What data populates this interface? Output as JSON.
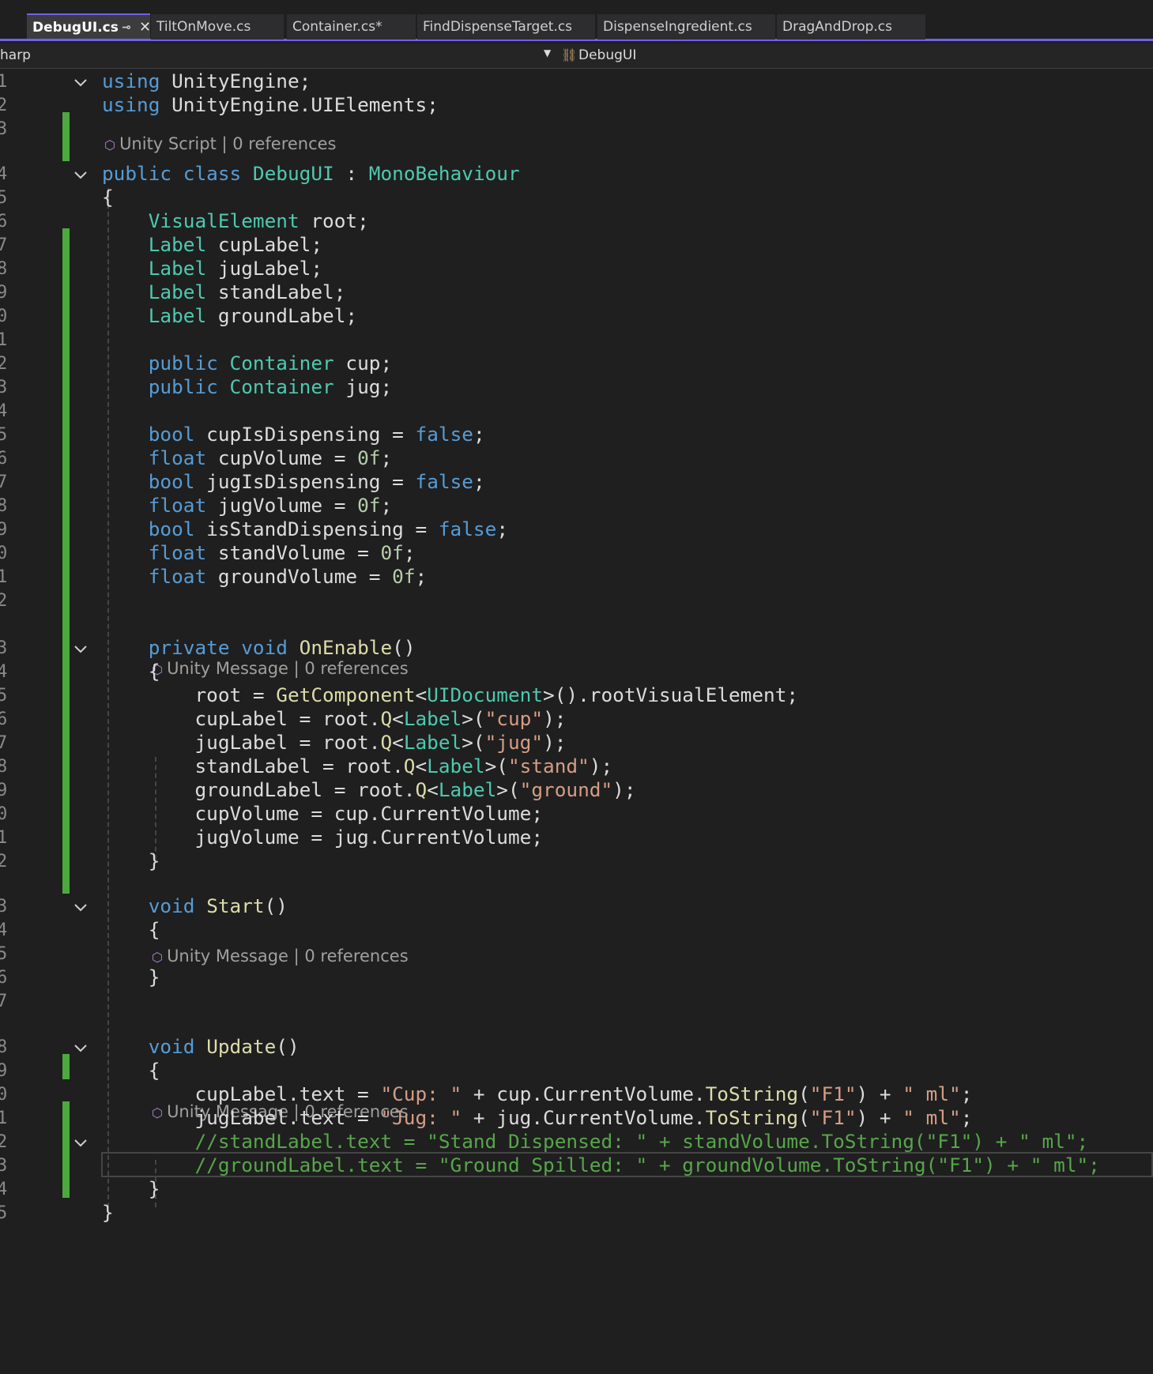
{
  "tabs": [
    {
      "label": "DebugUI.cs",
      "active": true
    },
    {
      "label": "TiltOnMove.cs",
      "active": false
    },
    {
      "label": "Container.cs*",
      "active": false
    },
    {
      "label": "FindDispenseTarget.cs",
      "active": false
    },
    {
      "label": "DispenseIngredient.cs",
      "active": false
    },
    {
      "label": "DragAndDrop.cs",
      "active": false
    }
  ],
  "tab_pin_icon": "pin-icon",
  "tab_close_icon": "close-icon",
  "nav": {
    "project": "harp",
    "member": "DebugUI"
  },
  "colors": {
    "accent": "#7160e8",
    "change_bar": "#4ea840",
    "keyword": "#569cd6",
    "type": "#4ec9b0",
    "method": "#dcdcaa",
    "string": "#d69d85",
    "number": "#b5cea8",
    "comment": "#57a64a"
  },
  "codelens": [
    {
      "label": "Unity Script | 0 references"
    },
    {
      "label": "Unity Message | 0 references"
    },
    {
      "label": "Unity Message | 0 references"
    },
    {
      "label": "Unity Message | 0 references"
    }
  ],
  "line_numbers": [
    "1",
    "2",
    "3",
    "4",
    "5",
    "6",
    "7",
    "8",
    "9",
    "0",
    "1",
    "2",
    "3",
    "4",
    "5",
    "6",
    "7",
    "8",
    "9",
    "0",
    "1",
    "2",
    "3",
    "4",
    "5",
    "6",
    "7",
    "8",
    "9",
    "0",
    "1",
    "2",
    "3",
    "4",
    "5",
    "6",
    "7",
    "8",
    "9",
    "0",
    "1",
    "2",
    "3",
    "4",
    "5"
  ],
  "lines": [
    [
      [
        "kw",
        "using"
      ],
      [
        "id",
        " UnityEngine;"
      ]
    ],
    [
      [
        "kw",
        "using"
      ],
      [
        "id",
        " UnityEngine.UIElements;"
      ]
    ],
    [],
    [
      [
        "kw",
        "public"
      ],
      [
        "id",
        " "
      ],
      [
        "kw",
        "class"
      ],
      [
        "id",
        " "
      ],
      [
        "ty",
        "DebugUI"
      ],
      [
        "id",
        " : "
      ],
      [
        "ty",
        "MonoBehaviour"
      ]
    ],
    [
      [
        "id",
        "{"
      ]
    ],
    [
      [
        "id",
        "    "
      ],
      [
        "ty",
        "VisualElement"
      ],
      [
        "id",
        " root;"
      ]
    ],
    [
      [
        "id",
        "    "
      ],
      [
        "ty",
        "Label"
      ],
      [
        "id",
        " cupLabel;"
      ]
    ],
    [
      [
        "id",
        "    "
      ],
      [
        "ty",
        "Label"
      ],
      [
        "id",
        " jugLabel;"
      ]
    ],
    [
      [
        "id",
        "    "
      ],
      [
        "ty",
        "Label"
      ],
      [
        "id",
        " standLabel;"
      ]
    ],
    [
      [
        "id",
        "    "
      ],
      [
        "ty",
        "Label"
      ],
      [
        "id",
        " groundLabel;"
      ]
    ],
    [],
    [
      [
        "id",
        "    "
      ],
      [
        "kw",
        "public"
      ],
      [
        "id",
        " "
      ],
      [
        "ty",
        "Container"
      ],
      [
        "id",
        " cup;"
      ]
    ],
    [
      [
        "id",
        "    "
      ],
      [
        "kw",
        "public"
      ],
      [
        "id",
        " "
      ],
      [
        "ty",
        "Container"
      ],
      [
        "id",
        " jug;"
      ]
    ],
    [],
    [
      [
        "id",
        "    "
      ],
      [
        "kw",
        "bool"
      ],
      [
        "id",
        " cupIsDispensing = "
      ],
      [
        "kw",
        "false"
      ],
      [
        "id",
        ";"
      ]
    ],
    [
      [
        "id",
        "    "
      ],
      [
        "kw",
        "float"
      ],
      [
        "id",
        " cupVolume = "
      ],
      [
        "nu",
        "0f"
      ],
      [
        "id",
        ";"
      ]
    ],
    [
      [
        "id",
        "    "
      ],
      [
        "kw",
        "bool"
      ],
      [
        "id",
        " jugIsDispensing = "
      ],
      [
        "kw",
        "false"
      ],
      [
        "id",
        ";"
      ]
    ],
    [
      [
        "id",
        "    "
      ],
      [
        "kw",
        "float"
      ],
      [
        "id",
        " jugVolume = "
      ],
      [
        "nu",
        "0f"
      ],
      [
        "id",
        ";"
      ]
    ],
    [
      [
        "id",
        "    "
      ],
      [
        "kw",
        "bool"
      ],
      [
        "id",
        " isStandDispensing = "
      ],
      [
        "kw",
        "false"
      ],
      [
        "id",
        ";"
      ]
    ],
    [
      [
        "id",
        "    "
      ],
      [
        "kw",
        "float"
      ],
      [
        "id",
        " standVolume = "
      ],
      [
        "nu",
        "0f"
      ],
      [
        "id",
        ";"
      ]
    ],
    [
      [
        "id",
        "    "
      ],
      [
        "kw",
        "float"
      ],
      [
        "id",
        " groundVolume = "
      ],
      [
        "nu",
        "0f"
      ],
      [
        "id",
        ";"
      ]
    ],
    [],
    [
      [
        "id",
        "    "
      ],
      [
        "kw",
        "private"
      ],
      [
        "id",
        " "
      ],
      [
        "kw",
        "void"
      ],
      [
        "id",
        " "
      ],
      [
        "fn",
        "OnEnable"
      ],
      [
        "id",
        "()"
      ]
    ],
    [
      [
        "id",
        "    {"
      ]
    ],
    [
      [
        "id",
        "        root = "
      ],
      [
        "fn",
        "GetComponent"
      ],
      [
        "id",
        "<"
      ],
      [
        "ty",
        "UIDocument"
      ],
      [
        "id",
        ">().rootVisualElement;"
      ]
    ],
    [
      [
        "id",
        "        cupLabel = root."
      ],
      [
        "fn",
        "Q"
      ],
      [
        "id",
        "<"
      ],
      [
        "ty",
        "Label"
      ],
      [
        "id",
        ">("
      ],
      [
        "st",
        "\"cup\""
      ],
      [
        "id",
        ");"
      ]
    ],
    [
      [
        "id",
        "        jugLabel = root."
      ],
      [
        "fn",
        "Q"
      ],
      [
        "id",
        "<"
      ],
      [
        "ty",
        "Label"
      ],
      [
        "id",
        ">("
      ],
      [
        "st",
        "\"jug\""
      ],
      [
        "id",
        ");"
      ]
    ],
    [
      [
        "id",
        "        standLabel = root."
      ],
      [
        "fn",
        "Q"
      ],
      [
        "id",
        "<"
      ],
      [
        "ty",
        "Label"
      ],
      [
        "id",
        ">("
      ],
      [
        "st",
        "\"stand\""
      ],
      [
        "id",
        ");"
      ]
    ],
    [
      [
        "id",
        "        groundLabel = root."
      ],
      [
        "fn",
        "Q"
      ],
      [
        "id",
        "<"
      ],
      [
        "ty",
        "Label"
      ],
      [
        "id",
        ">("
      ],
      [
        "st",
        "\"ground\""
      ],
      [
        "id",
        ");"
      ]
    ],
    [
      [
        "id",
        "        cupVolume = cup.CurrentVolume;"
      ]
    ],
    [
      [
        "id",
        "        jugVolume = jug.CurrentVolume;"
      ]
    ],
    [
      [
        "id",
        "    }"
      ]
    ],
    [
      [
        "id",
        "    "
      ],
      [
        "kw",
        "void"
      ],
      [
        "id",
        " "
      ],
      [
        "fn",
        "Start"
      ],
      [
        "id",
        "()"
      ]
    ],
    [
      [
        "id",
        "    {"
      ]
    ],
    [],
    [
      [
        "id",
        "    }"
      ]
    ],
    [],
    [
      [
        "id",
        "    "
      ],
      [
        "kw",
        "void"
      ],
      [
        "id",
        " "
      ],
      [
        "fn",
        "Update"
      ],
      [
        "id",
        "()"
      ]
    ],
    [
      [
        "id",
        "    {"
      ]
    ],
    [
      [
        "id",
        "        cupLabel.text = "
      ],
      [
        "st",
        "\"Cup: \""
      ],
      [
        "id",
        " + cup.CurrentVolume."
      ],
      [
        "fn",
        "ToString"
      ],
      [
        "id",
        "("
      ],
      [
        "st",
        "\"F1\""
      ],
      [
        "id",
        ") + "
      ],
      [
        "st",
        "\" ml\""
      ],
      [
        "id",
        ";"
      ]
    ],
    [
      [
        "id",
        "        jugLabel.text = "
      ],
      [
        "st",
        "\"Jug: \""
      ],
      [
        "id",
        " + jug.CurrentVolume."
      ],
      [
        "fn",
        "ToString"
      ],
      [
        "id",
        "("
      ],
      [
        "st",
        "\"F1\""
      ],
      [
        "id",
        ") + "
      ],
      [
        "st",
        "\" ml\""
      ],
      [
        "id",
        ";"
      ]
    ],
    [
      [
        "id",
        "        "
      ],
      [
        "cm",
        "//standLabel.text = \"Stand Dispensed: \" + standVolume.ToString(\"F1\") + \" ml\";"
      ]
    ],
    [
      [
        "id",
        "        "
      ],
      [
        "cm",
        "//groundLabel.text = \"Ground Spilled: \" + groundVolume.ToString(\"F1\") + \" ml\";"
      ]
    ],
    [
      [
        "id",
        "    }"
      ]
    ],
    [
      [
        "id",
        "}"
      ]
    ]
  ]
}
